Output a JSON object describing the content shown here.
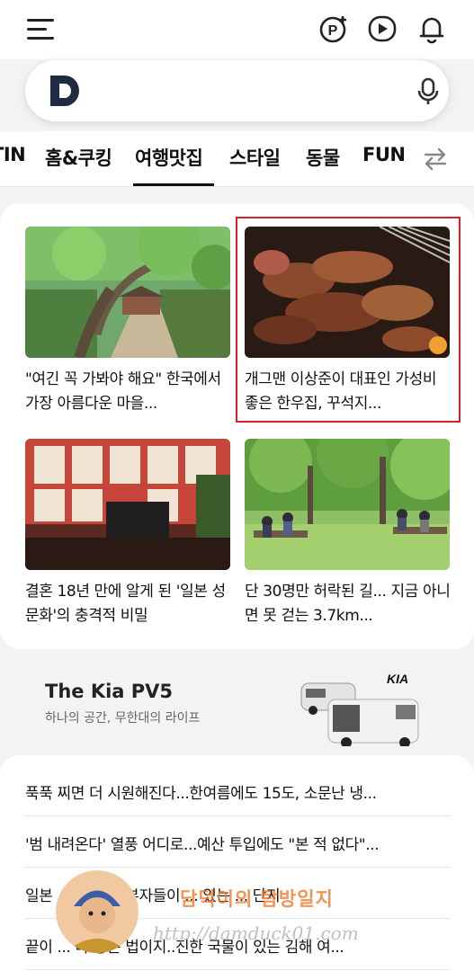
{
  "header": {
    "menu_icon": "hamburger-menu-icon",
    "icons": [
      "pay-plus-icon",
      "play-icon",
      "bell-icon"
    ]
  },
  "search": {
    "logo_letter": "D",
    "mic_icon": "microphone-icon"
  },
  "tabs": [
    {
      "label": "TIN"
    },
    {
      "label": "홈&쿠킹"
    },
    {
      "label": "여행맛집",
      "active": true
    },
    {
      "label": "스타일"
    },
    {
      "label": "동물"
    },
    {
      "label": "FUN"
    }
  ],
  "tabs_swap_icon": "swap-arrows-icon",
  "articles": [
    {
      "caption": "\"여긴 꼭 가봐야 해요\" 한국에서 가장 아름다운 마을...",
      "image": "village-tree-path"
    },
    {
      "caption": "개그맨 이상준이 대표인 가성비 좋은 한우집, 꾸석지...",
      "image": "grilled-beef",
      "highlighted": true
    },
    {
      "caption": "결혼 18년 만에 알게 된 '일본 성 문화'의 충격적 비밀",
      "image": "museum-exhibit"
    },
    {
      "caption": "단 30명만 허락된 길... 지금 아니면 못 걷는 3.7km...",
      "image": "forest-picnic"
    }
  ],
  "ad": {
    "title": "The Kia PV5",
    "subtitle": "하나의 공간, 무한대의 라이프",
    "brand_logo": "KIA"
  },
  "news": [
    "푹푹 찌면 더 시원해진다...한여름에도 15도, 소문난 냉...",
    "'범 내려온다' 열풍 어디로...예산 투입에도 \"본 적 없다\"...",
    "일본 ... 아파트, 부자들이 ... 있는 ... 단지",
    "끝이 ... 다 좋은 법이지..진한 국물이 있는 김해 여..."
  ],
  "watermark": {
    "text": "담덕이의 탐방일지",
    "url": "http://damduck01.com"
  }
}
